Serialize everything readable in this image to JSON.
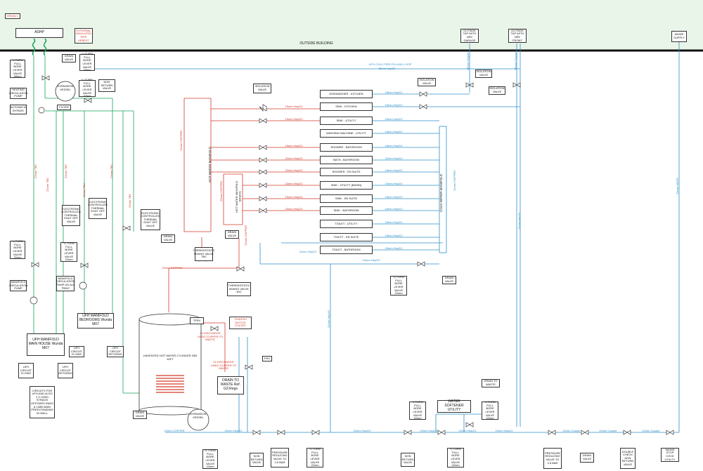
{
  "header": {
    "drain_tag": "DRAIN 1",
    "outside_building": "OUTSIDE BUILDING",
    "ashp": "ASHP",
    "external_heat_wrap": "EXTERNAL INSULATED PIPE HEBEST",
    "outside_tap_garage": "OUTSIDE TAP WITH NRV GARAGE",
    "outside_tap_front": "OUTSIDE TAP WITH NRV FRONT",
    "mains_supply": "MAINS SUPPLY"
  },
  "left_components": {
    "drain_valve": "DRAIN VALVE",
    "lever_valve_28_a": "¼ TURN FULL BORE LEVER VALVE 28mm",
    "lever_valve_28_b": "¼ TURN FULL BORE LEVER VALVE 28mm",
    "heating_pump": "HEATING CIRCULATION PUMP",
    "auto_bypass": "AUTOMATIC BYPASS",
    "expansion_vessel": "EXPANSION VESSEL",
    "filter": "FILTER",
    "lever_valve_22_c": "¼ TURN FULL BORE LEVER VALVE 22mm",
    "non_return_valve": "NON RETURN VALVE",
    "thermal_valve_1": "ELECTRONIC CONTROLLED THERMAL SHUT OFF VALVE",
    "thermal_valve_2": "ELECTRONIC CONTROLLED THERMAL SHUT OFF VALVE",
    "thermal_valve_3": "ELECTRONIC CONTROLLED THERMAL SHUT OFF VALVE",
    "lever_valve_22_d": "¼ TURN FULL BORE LEVER VALVE 22mm",
    "lever_valve_22_e": "¼ TURN FULL BORE LEVER VALVE 22mm",
    "manifold_pump": "MANIFOLD CIRCULATION PUMP",
    "manifold_pump_2": "MANIFOLD CIRCULATION PUMP UN ALL TRIM?",
    "ufh_manifold_main": "UFH MANIFOLD MAIN HOUSE Wunda M07",
    "ufh_manifold_bed": "UFH MANIFOLD BEDROOMS Wunda M07",
    "ufh_flows_1": "UFH CIRCUIT FLOWS",
    "ufh_returns_1": "UFH CIRCUIT RETURNS",
    "ufh_flows_2": "UFH CIRCUIT FLOWS",
    "ufh_returns_2": "UFH CIRCUIT RETURNS",
    "circuits_note": "CIRCUITS FOR UFH AND ALSO 2 X USED STRAGS UPSTAIRS RADS & LIMB MAIN PREEXTANDING IN WALL",
    "pipe_22_tbc_1": "22mm TBC",
    "pipe_22_tbc_2": "22mm TBC",
    "pipe_22_tbc_3": "22mm TBC",
    "pipe_22_tbc_4": "22mm TBC",
    "pipe_22_tbc_5": "22mm TBC",
    "pipe_22_tbc_6": "22mm TBC"
  },
  "hot_side": {
    "isolation_valve": "ISOLATION VALVE",
    "hot_manifold": "HOT WATER MANIFOLD",
    "hot_manifold_basins": "HOT WATER MANIFOLD BASINS",
    "drain_valve_a": "DRAIN VALVE",
    "drain_valve_b": "DRAIN VALVE",
    "tmv_basins": "THERMOSTATIC MIXING VALVE TBC",
    "tmv_40c": "THERMOSTATIC MIXING VALVE 40C",
    "copper_22_a": "22mm COPPER",
    "copper_22_b": "22mm COPPER",
    "copper_22_c": "22mm COPPER",
    "copper_22_d": "22mm COPPER",
    "cylinder": "UNVENTED HOT WATER CYLINDER 250l 40FT",
    "tprv": "TPRV",
    "tundish": "TUNDISH NOTICE COLOR?",
    "discharge_note_1": "15 DISCHARGE UNDO COPPER TO WASTE",
    "discharge_note_2": "22 DISCHARGE UNDO COPPER TO WASTE",
    "drain_to_waste": "DRAIN TO WASTE Ref. G3 Regs",
    "prv": "PRV",
    "expansion_vessel_2": "EXPANSION VESSEL",
    "drain_valve_c": "DRAIN VALVE"
  },
  "feeds": {
    "ufh_cold_loop_1": "UFH COLD FEED FILLING LOOP",
    "ufh_cold_loop_2": "15mm Hep20",
    "feed_hot": [
      "15mm Hep2O",
      "15mm Hep2O",
      "15mm Hep2O",
      "22mm Hep2O",
      "22mm Hep2O",
      "15mm Hep2O",
      "15mm Hep2O",
      "15mm Hep2O",
      "15mm Hep2O"
    ],
    "feed_cold": [
      "15mm Hep2O",
      "15mm Hep2O",
      "15mm Hep2O",
      "15mm Hep2O",
      "15mm Hep2O",
      "22mm Hep2O",
      "15mm Hep2O",
      "15mm Hep2O",
      "15mm Hep2O",
      "15mm Hep2O",
      "15mm Hep2O",
      "15mm Hep2O",
      "15mm Hep2O"
    ],
    "cold_22_hep": "22mm Hep2O",
    "cold_22_hep_b": "22mm Hep2O",
    "cold_15_copper_a": "15mm Copper",
    "cold_15_copper_b": "15mm Copper",
    "cold_15_hep_v": "15mm Hep20",
    "cold_22_hep_v": "22mm Hep2O",
    "mdpe_25": "25mm MDPE",
    "isolation_valve_a": "ISOLATION VALVE",
    "isolation_valve_b": "ISOLATION VALVE",
    "isolation_valve_c": "ISOLATION VALVE"
  },
  "outlets": [
    "DISHWASHER - KITCHEN",
    "SINK - KITCHEN",
    "SINK - UTILITY",
    "WASHING MACHINE - UTILITY",
    "SHOWER - BATHROOM",
    "BATH - BATHROOM",
    "SHOWER - EN SUITE",
    "SINK - UTILITY (BASIN)",
    "SINK - EN SUITE",
    "SINK - BATHROOM",
    "TOILET - UTILITY",
    "TOILET - EN SUITE",
    "TOILET - BATHROOM"
  ],
  "cold_side": {
    "cold_manifold": "COLD WATER MANIFOLD",
    "cold_manifold_pipe": "22mm COPPER",
    "drain_valve": "DRAIN VALVE",
    "lever_valve_cold": "¼ TURN FULL BORE LEVER VALVE 22mm",
    "cold_22_label": "22mm Hep2O",
    "cold_vert_22": "22mm Hep2O"
  },
  "bottom": {
    "water_softener": "WATER SOFTENER UTILITY",
    "drain_to_waste_2": "DRAIN TO WASTE",
    "lever_valve_l": "¼ TURN FULL BORE LEVER VALVE 22mm",
    "lever_valve_r": "¼ TURN FULL BORE LEVER VALVE 22mm",
    "bottom_pipe_labels": [
      "22mm COPPER",
      "22mm Hep2O",
      "22mm Hep2O",
      "22mm Hep2O",
      "22mm Hep2O",
      "22mm Hep2O",
      "22mm Copper",
      "22mm Copper",
      "22mm Copper"
    ],
    "bottom_valves": [
      "¼ TURN FULL BORE LEVER VALVE 22mm",
      "NON RETURN VALVE",
      "PRESSURE REDUCING VALVE TO 3.5 BAR",
      "¼ TURN FULL BORE LEVER VALVE 22mm",
      "NON RETURN VALVE",
      "¼ TURN FULL BORE LEVER VALVE 22mm",
      "PRESSURE REDUCING VALVE TO 3.5 BAR",
      "DRAIN VALVE",
      "DOUBLE CHECK NON RETURN VALVE",
      "MAINS STOP COCK UTILITY"
    ]
  },
  "colors": {
    "cold": "#2e8fc9",
    "hot": "#d23a2a",
    "heating": "#19a35a",
    "ground": "#1c1c1c"
  }
}
